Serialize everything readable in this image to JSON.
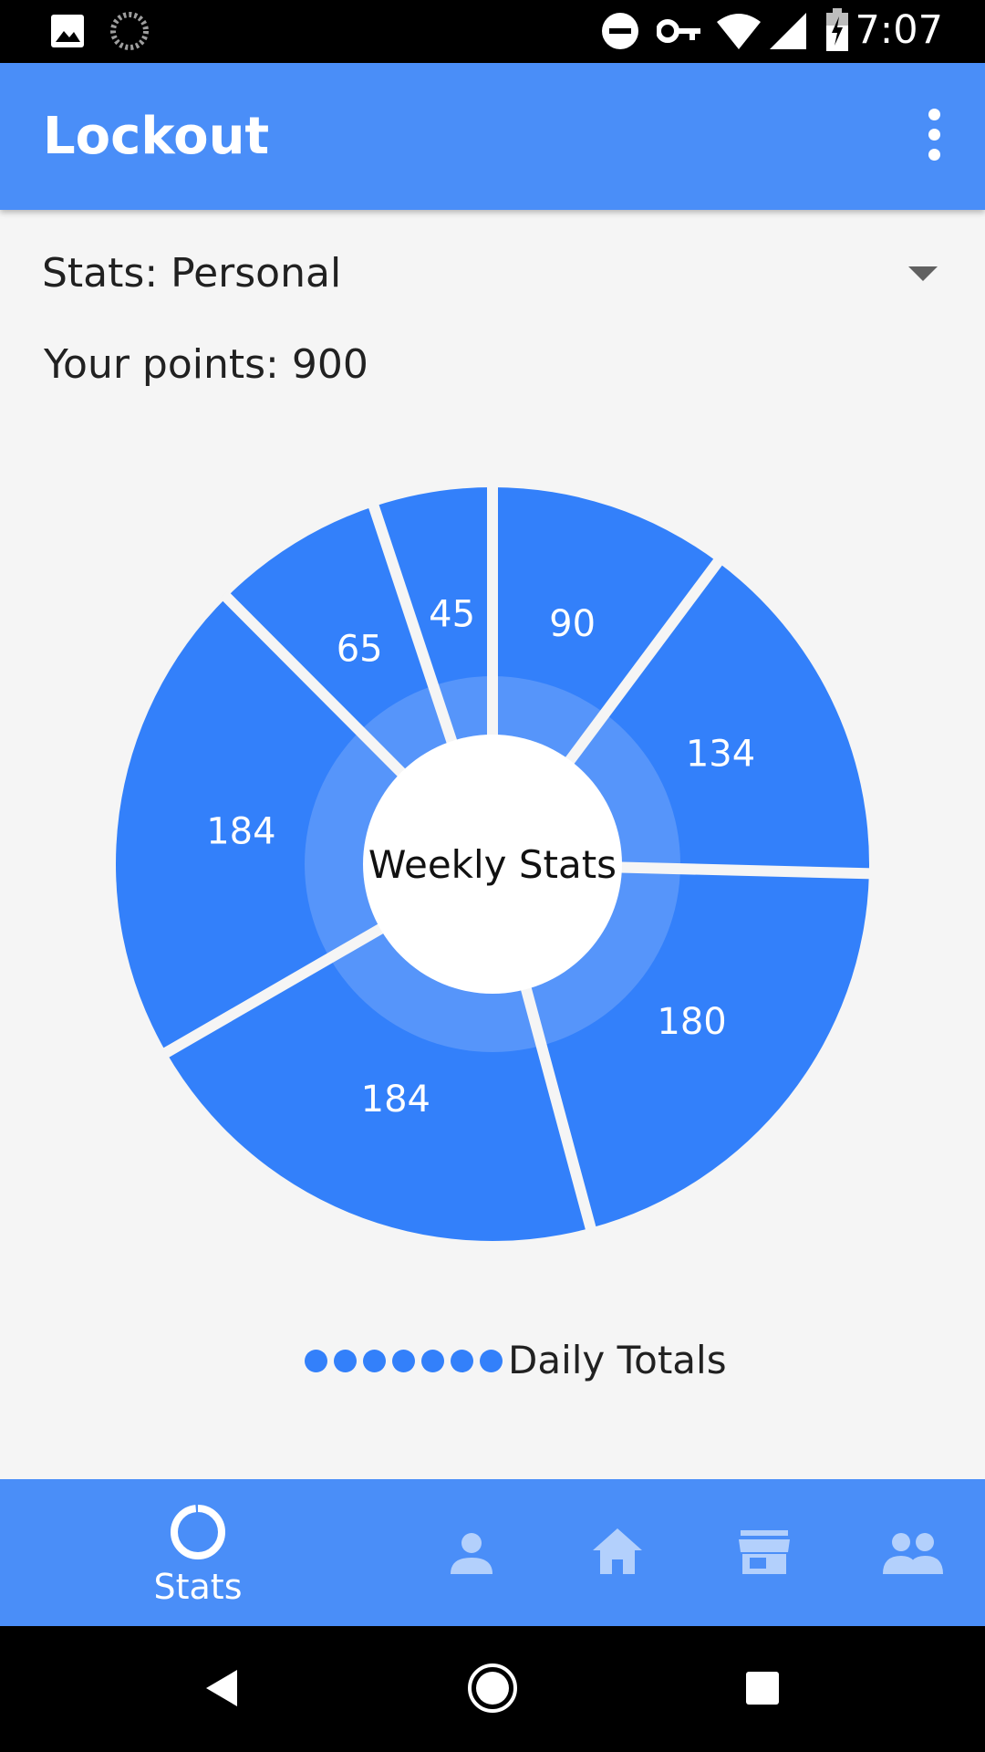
{
  "status_bar": {
    "time": "7:07",
    "icons": [
      "image-icon",
      "sync-spinner-icon",
      "do-not-disturb-icon",
      "vpn-key-icon",
      "wifi-icon",
      "signal-icon",
      "battery-charging-icon"
    ]
  },
  "app_bar": {
    "title": "Lockout",
    "menu_icon": "more-vert-icon"
  },
  "selector": {
    "label": "Stats: Personal",
    "caret_icon": "arrow-drop-down-icon"
  },
  "points_text": "Your points: 900",
  "chart_data": {
    "type": "pie",
    "title": "Weekly Stats",
    "values": [
      90,
      134,
      180,
      184,
      184,
      65,
      45
    ],
    "labels": [
      "90",
      "134",
      "180",
      "184",
      "184",
      "65",
      "45"
    ],
    "legend": {
      "label": "Daily Totals",
      "markers": 7
    }
  },
  "colors": {
    "primary": "#4a8ef8",
    "slice": "#3380fa",
    "inner_ring": "#5a97f9",
    "background": "#f5f5f5"
  },
  "bottom_nav": {
    "items": [
      {
        "label": "Stats",
        "icon": "donut-chart-icon",
        "active": true
      },
      {
        "label": "",
        "icon": "person-icon",
        "active": false
      },
      {
        "label": "",
        "icon": "home-icon",
        "active": false
      },
      {
        "label": "",
        "icon": "store-icon",
        "active": false
      },
      {
        "label": "",
        "icon": "group-icon",
        "active": false
      }
    ]
  },
  "system_nav": [
    "back-icon",
    "home-circle-icon",
    "recents-icon"
  ]
}
